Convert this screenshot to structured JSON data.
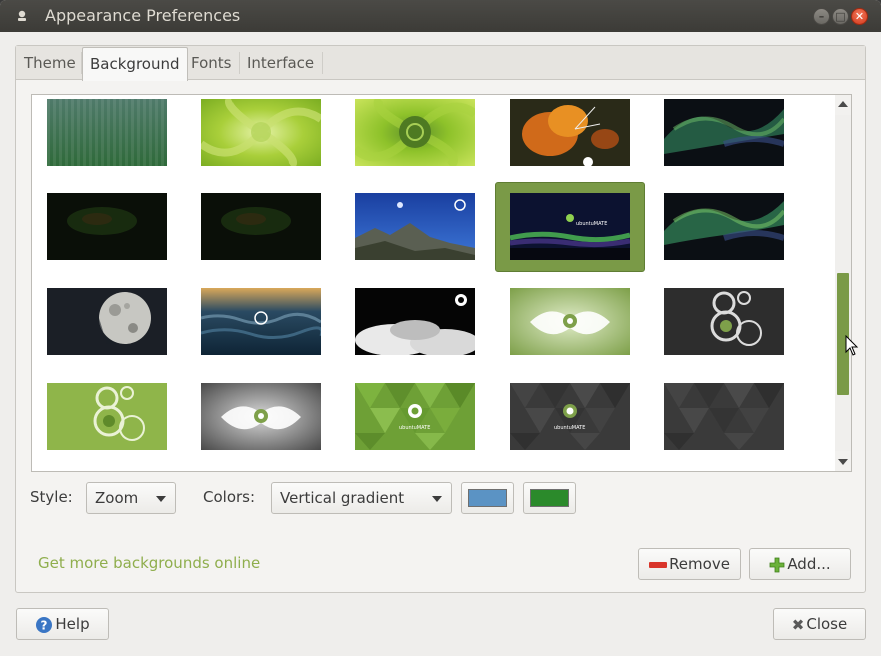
{
  "window": {
    "title": "Appearance Preferences"
  },
  "tabs": [
    {
      "label": "Theme",
      "active": false
    },
    {
      "label": "Background",
      "active": true
    },
    {
      "label": "Fonts",
      "active": false
    },
    {
      "label": "Interface",
      "active": false
    }
  ],
  "gallery": {
    "selected_index": 8,
    "thumbnail_names": [
      "green-striped",
      "green-swirl-light",
      "green-swirl-logo",
      "orange-flower",
      "aurora-dark",
      "dark-green-blur",
      "dark-green-blur-2",
      "mountain-sky-logo",
      "ubuntu-mate-aurora",
      "aurora-dark-2",
      "moon-surface",
      "ocean-waves-logo",
      "white-clouds-logo",
      "green-splash-logo",
      "gray-circles-logo",
      "green-circles-logo",
      "gray-splash-logo",
      "green-triangles-logo",
      "gray-triangles-logo",
      "gray-triangles"
    ],
    "thumb_text": "ubuntuMATE"
  },
  "style": {
    "label": "Style:",
    "value": "Zoom"
  },
  "colors": {
    "label": "Colors:",
    "value": "Vertical gradient",
    "primary": "#5b93c4",
    "secondary": "#2b8a2b"
  },
  "more_link": "Get more backgrounds online",
  "buttons": {
    "remove": "Remove",
    "add": "Add...",
    "help": "Help",
    "close": "Close"
  },
  "accent": "#7a9a47"
}
